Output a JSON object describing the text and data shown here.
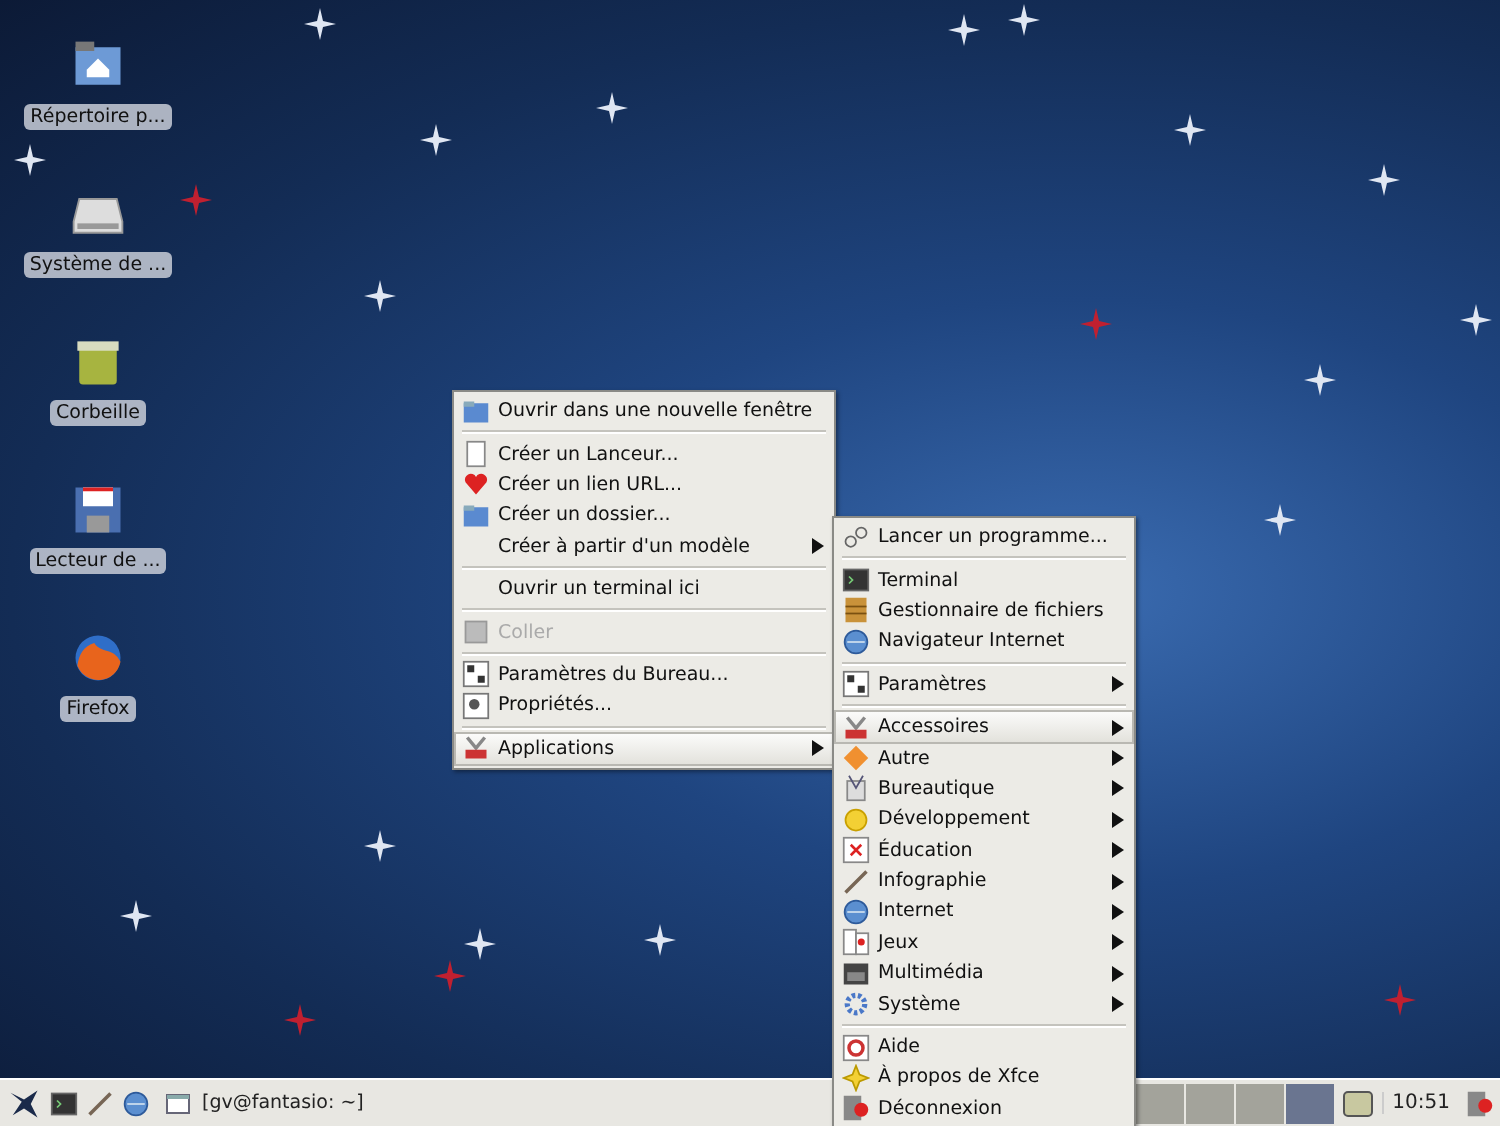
{
  "desktop_icons": [
    {
      "label": "Répertoire p..."
    },
    {
      "label": "Système de ..."
    },
    {
      "label": "Corbeille"
    },
    {
      "label": "Lecteur de ..."
    },
    {
      "label": "Firefox"
    }
  ],
  "desktop_menu": {
    "items": [
      {
        "kind": "item",
        "label": "Ouvrir dans une nouvelle fenêtre",
        "disabled": false,
        "submenu": false,
        "selected": false
      },
      {
        "kind": "separator"
      },
      {
        "kind": "item",
        "label": "Créer un Lanceur...",
        "disabled": false,
        "submenu": false,
        "selected": false
      },
      {
        "kind": "item",
        "label": "Créer un lien URL...",
        "disabled": false,
        "submenu": false,
        "selected": false
      },
      {
        "kind": "item",
        "label": "Créer un dossier...",
        "disabled": false,
        "submenu": false,
        "selected": false
      },
      {
        "kind": "item",
        "label": "Créer à partir d'un modèle",
        "disabled": false,
        "submenu": true,
        "selected": false
      },
      {
        "kind": "separator"
      },
      {
        "kind": "item",
        "label": "Ouvrir un terminal ici",
        "disabled": false,
        "submenu": false,
        "selected": false
      },
      {
        "kind": "separator"
      },
      {
        "kind": "item",
        "label": "Coller",
        "disabled": true,
        "submenu": false,
        "selected": false
      },
      {
        "kind": "separator"
      },
      {
        "kind": "item",
        "label": "Paramètres du Bureau...",
        "disabled": false,
        "submenu": false,
        "selected": false
      },
      {
        "kind": "item",
        "label": "Propriétés...",
        "disabled": false,
        "submenu": false,
        "selected": false
      },
      {
        "kind": "separator"
      },
      {
        "kind": "item",
        "label": "Applications",
        "disabled": false,
        "submenu": true,
        "selected": true
      }
    ]
  },
  "applications_menu": {
    "items": [
      {
        "kind": "item",
        "label": "Lancer un programme...",
        "submenu": false,
        "selected": false
      },
      {
        "kind": "separator"
      },
      {
        "kind": "item",
        "label": "Terminal",
        "submenu": false,
        "selected": false
      },
      {
        "kind": "item",
        "label": "Gestionnaire de fichiers",
        "submenu": false,
        "selected": false
      },
      {
        "kind": "item",
        "label": "Navigateur Internet",
        "submenu": false,
        "selected": false
      },
      {
        "kind": "separator"
      },
      {
        "kind": "item",
        "label": "Paramètres",
        "submenu": true,
        "selected": false
      },
      {
        "kind": "separator"
      },
      {
        "kind": "item",
        "label": "Accessoires",
        "submenu": true,
        "selected": true
      },
      {
        "kind": "item",
        "label": "Autre",
        "submenu": true,
        "selected": false
      },
      {
        "kind": "item",
        "label": "Bureautique",
        "submenu": true,
        "selected": false
      },
      {
        "kind": "item",
        "label": "Développement",
        "submenu": true,
        "selected": false
      },
      {
        "kind": "item",
        "label": "Éducation",
        "submenu": true,
        "selected": false
      },
      {
        "kind": "item",
        "label": "Infographie",
        "submenu": true,
        "selected": false
      },
      {
        "kind": "item",
        "label": "Internet",
        "submenu": true,
        "selected": false
      },
      {
        "kind": "item",
        "label": "Jeux",
        "submenu": true,
        "selected": false
      },
      {
        "kind": "item",
        "label": "Multimédia",
        "submenu": true,
        "selected": false
      },
      {
        "kind": "item",
        "label": "Système",
        "submenu": true,
        "selected": false
      },
      {
        "kind": "separator"
      },
      {
        "kind": "item",
        "label": "Aide",
        "submenu": false,
        "selected": false
      },
      {
        "kind": "item",
        "label": "À propos de Xfce",
        "submenu": false,
        "selected": false
      },
      {
        "kind": "item",
        "label": "Déconnexion",
        "submenu": false,
        "selected": false
      }
    ]
  },
  "taskbar": {
    "task": {
      "label": "[gv@fantasio: ~]"
    },
    "workspaces": [
      {
        "selected": false
      },
      {
        "selected": false
      },
      {
        "selected": false
      },
      {
        "selected": true
      }
    ],
    "clock": "10:51"
  }
}
